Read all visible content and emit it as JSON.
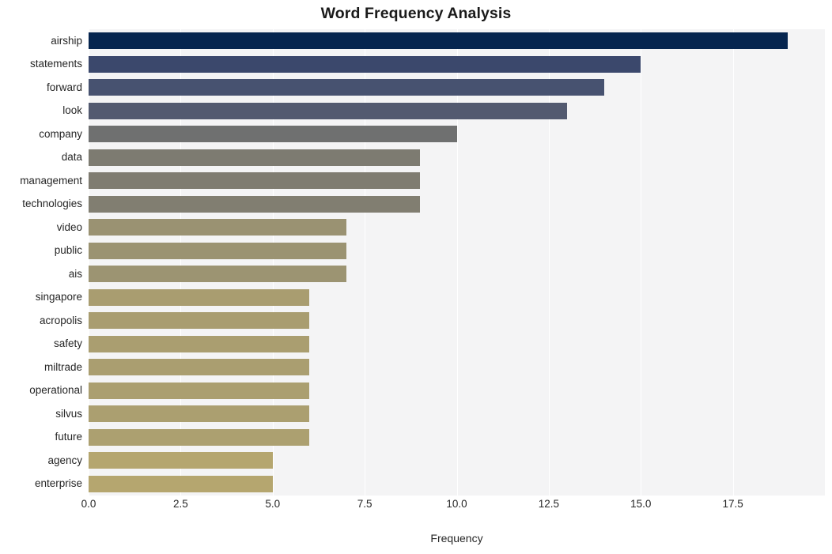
{
  "chart_data": {
    "type": "bar",
    "orientation": "horizontal",
    "title": "Word Frequency Analysis",
    "xlabel": "Frequency",
    "ylabel": "",
    "categories": [
      "airship",
      "statements",
      "forward",
      "look",
      "company",
      "data",
      "management",
      "technologies",
      "video",
      "public",
      "ais",
      "singapore",
      "acropolis",
      "safety",
      "miltrade",
      "operational",
      "silvus",
      "future",
      "agency",
      "enterprise"
    ],
    "values": [
      19,
      15,
      14,
      13,
      10,
      9,
      9,
      9,
      7,
      7,
      7,
      6,
      6,
      6,
      6,
      6,
      6,
      6,
      5,
      5
    ],
    "bar_colors": [
      "#06254f",
      "#3b486c",
      "#475270",
      "#535a70",
      "#6f7070",
      "#7d7b71",
      "#7f7c71",
      "#817e71",
      "#9a9272",
      "#9b9372",
      "#9c9472",
      "#a99d70",
      "#a99d70",
      "#aa9e70",
      "#aa9e70",
      "#ab9f70",
      "#ab9f70",
      "#aca070",
      "#b5a66f",
      "#b5a66f"
    ],
    "xticks": [
      0.0,
      2.5,
      5.0,
      7.5,
      10.0,
      12.5,
      15.0,
      17.5
    ],
    "xtick_labels": [
      "0.0",
      "2.5",
      "5.0",
      "7.5",
      "10.0",
      "12.5",
      "15.0",
      "17.5"
    ],
    "xlim": [
      0,
      20
    ],
    "ylim_count": 20,
    "grid": true,
    "grid_axis": "x",
    "grid_color": "#ffffff",
    "plot_background": "#f4f4f5",
    "figure_background": "#ffffff",
    "legend": null
  }
}
